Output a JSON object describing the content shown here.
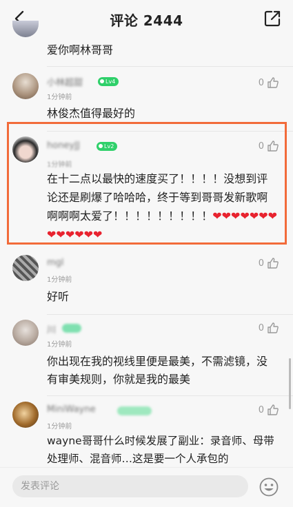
{
  "header": {
    "title": "评论 2444"
  },
  "comments": [
    {
      "text": "爱你啊林哥哥"
    },
    {
      "name": "小林超甜",
      "badge": "Lv4",
      "time": "1分钟前",
      "likes": "0",
      "text": "林俊杰值得最好的"
    },
    {
      "name": "honeyJJ",
      "badge": "Lv2",
      "time": "1分钟前",
      "likes": "0",
      "text": "在十二点以最快的速度买了！！！！没想到评论还是刷爆了哈哈哈，终于等到哥哥发新歌啊啊啊啊太爱了！！！！！！！！！❤❤❤❤❤❤❤❤❤❤❤❤❤"
    },
    {
      "name": "mgl",
      "time": "1分钟前",
      "likes": "0",
      "text": "好听"
    },
    {
      "name": "川",
      "time": "1分钟前",
      "likes": "0",
      "text": "你出现在我的视线里便是最美，不需滤镜，没有审美规则，你就是我的最美"
    },
    {
      "name": "MiniWayne",
      "time": "1分钟前",
      "likes": "0",
      "text": "wayne哥哥什么时候发展了副业：录音师、母带处理师、混音师…这是要一个人承包的"
    }
  ],
  "footer": {
    "placeholder": "发表评论"
  },
  "colors": {
    "highlight": "#f26b3a",
    "badge": "#2fd06a"
  }
}
